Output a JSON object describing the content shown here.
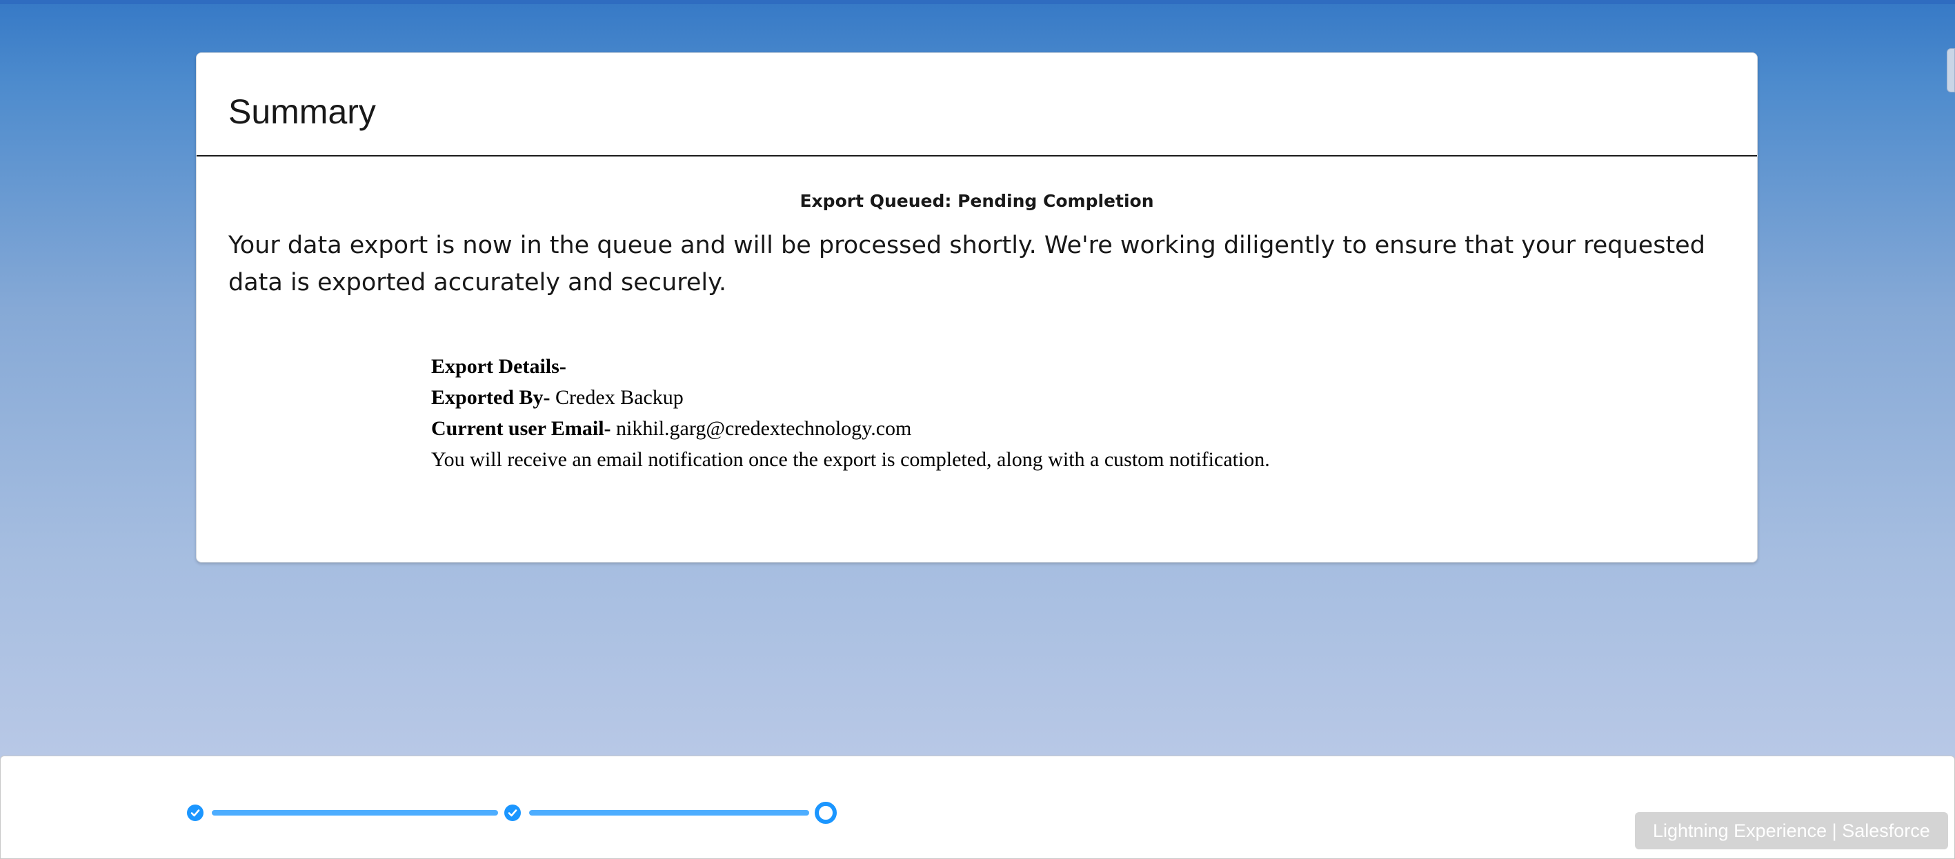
{
  "card": {
    "title": "Summary",
    "status_title": "Export Queued: Pending Completion",
    "message": "Your data export is now in the queue and will be processed shortly. We're working diligently to ensure that your requested data is exported accurately and securely."
  },
  "details": {
    "heading": "Export Details-",
    "exported_by_label": "Exported By-",
    "exported_by_value": "Credex Backup",
    "email_label": "Current user Email-",
    "email_value": "nikhil.garg@credextechnology.com",
    "note": "You will receive an email notification once the export is completed, along with a custom notification."
  },
  "progress": {
    "steps": [
      {
        "state": "complete",
        "icon": "check-icon"
      },
      {
        "state": "complete",
        "icon": "check-icon"
      },
      {
        "state": "current",
        "icon": "ring-icon"
      }
    ],
    "accent": "#1b96ff"
  },
  "tooltip": {
    "text": "Lightning Experience | Salesforce"
  }
}
